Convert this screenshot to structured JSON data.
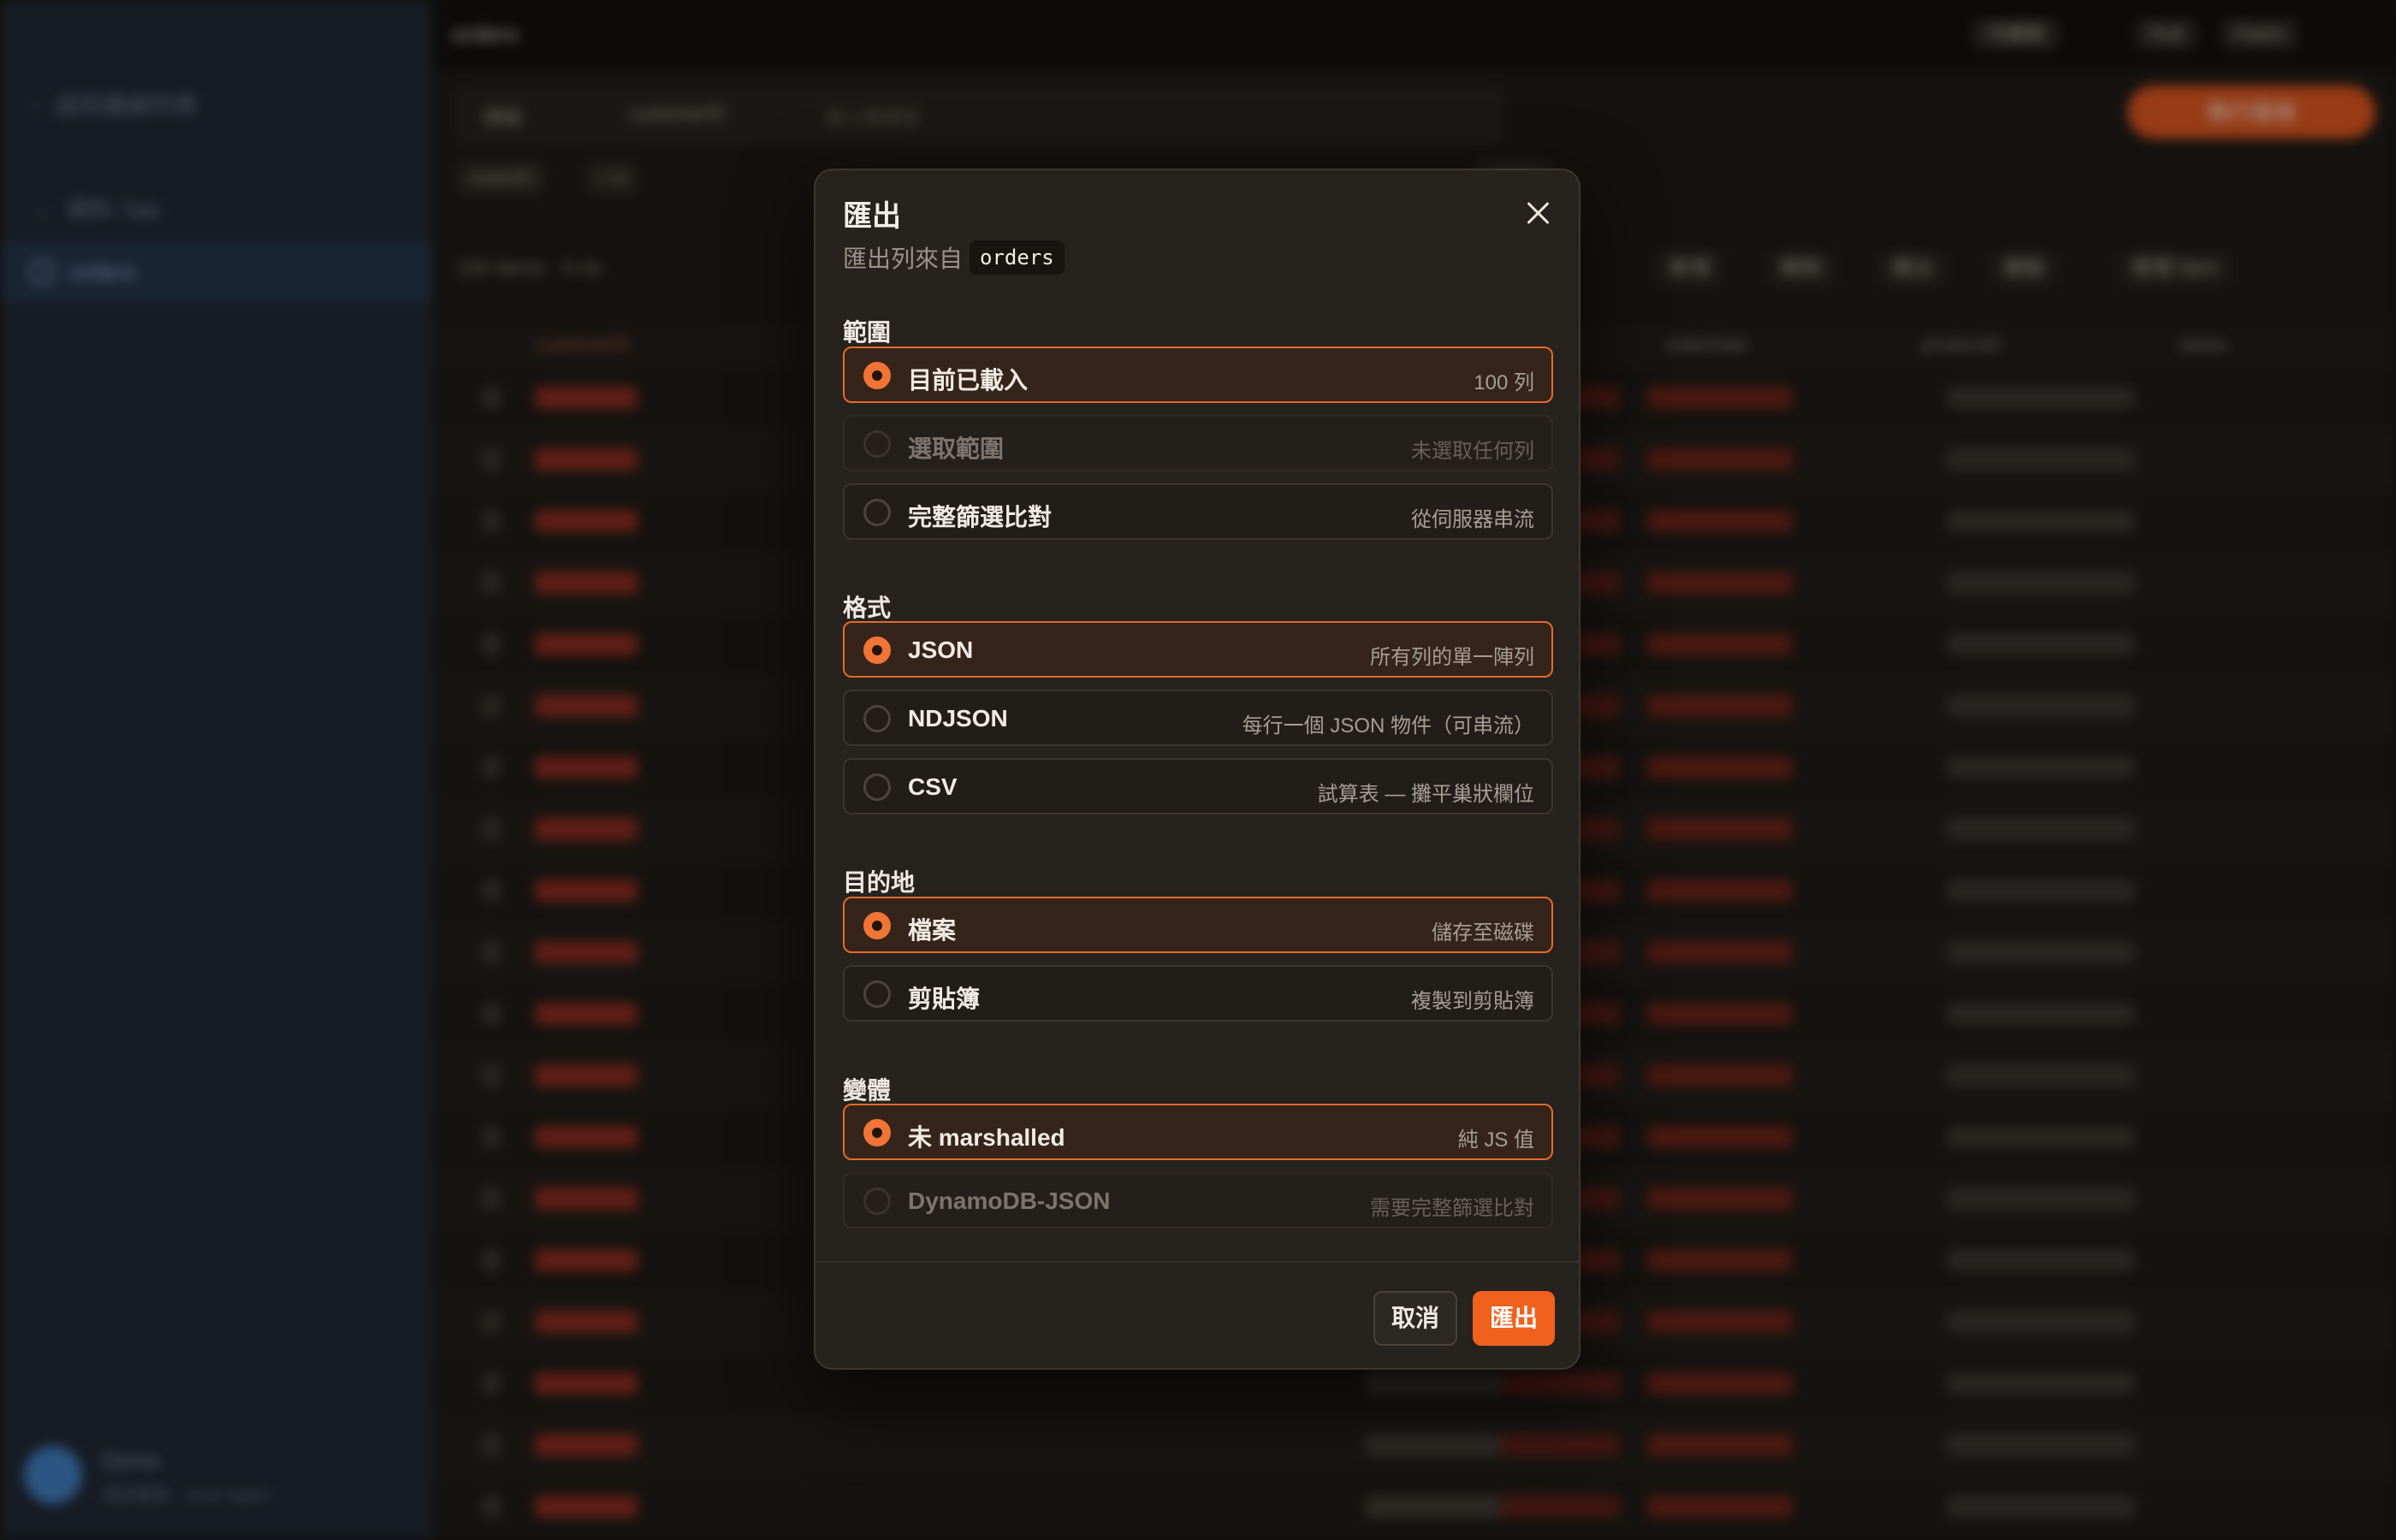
{
  "background": {
    "sidebar": {
      "back_label": "返回連線列表",
      "section_label": "資料 Tab",
      "active_table": "orders",
      "user_name": "Demo",
      "user_detail": "測試帳號 · local region"
    },
    "topbar": {
      "title": "orders",
      "pill_1": "可讀寫",
      "pill_2": "Pull",
      "pill_3": "Fetch"
    },
    "query": {
      "mode": "掃描",
      "key": "customerID",
      "placeholder": "輸入篩選值",
      "run_label": "執行查詢"
    },
    "filter_chips": [
      "orderID",
      "= A",
      "status"
    ],
    "toolbar": {
      "count_label": "100 items · 0.4s",
      "actions": [
        "新增",
        "刪除",
        "匯出",
        "複製",
        "欄位設定",
        "管理 Item"
      ]
    },
    "columns": [
      "customerID",
      "orderDate",
      "productID",
      "status"
    ],
    "row_count": 19
  },
  "modal": {
    "title": "匯出",
    "subtitle_prefix": "匯出列來自",
    "table_name": "orders",
    "sections": [
      {
        "label": "範圍",
        "options": [
          {
            "label": "目前已載入",
            "hint": "100 列",
            "selected": true,
            "disabled": false
          },
          {
            "label": "選取範圍",
            "hint": "未選取任何列",
            "selected": false,
            "disabled": true
          },
          {
            "label": "完整篩選比對",
            "hint": "從伺服器串流",
            "selected": false,
            "disabled": false
          }
        ]
      },
      {
        "label": "格式",
        "options": [
          {
            "label": "JSON",
            "hint": "所有列的單一陣列",
            "selected": true,
            "disabled": false
          },
          {
            "label": "NDJSON",
            "hint": "每行一個 JSON 物件（可串流）",
            "selected": false,
            "disabled": false
          },
          {
            "label": "CSV",
            "hint": "試算表 — 攤平巢狀欄位",
            "selected": false,
            "disabled": false
          }
        ]
      },
      {
        "label": "目的地",
        "options": [
          {
            "label": "檔案",
            "hint": "儲存至磁碟",
            "selected": true,
            "disabled": false
          },
          {
            "label": "剪貼簿",
            "hint": "複製到剪貼簿",
            "selected": false,
            "disabled": false
          }
        ]
      },
      {
        "label": "變體",
        "options": [
          {
            "label": "未 marshalled",
            "hint": "純 JS 值",
            "selected": true,
            "disabled": false
          },
          {
            "label": "DynamoDB-JSON",
            "hint": "需要完整篩選比對",
            "selected": false,
            "disabled": true
          }
        ]
      }
    ],
    "cancel_label": "取消",
    "export_label": "匯出",
    "accent_color": "#f0611e"
  }
}
